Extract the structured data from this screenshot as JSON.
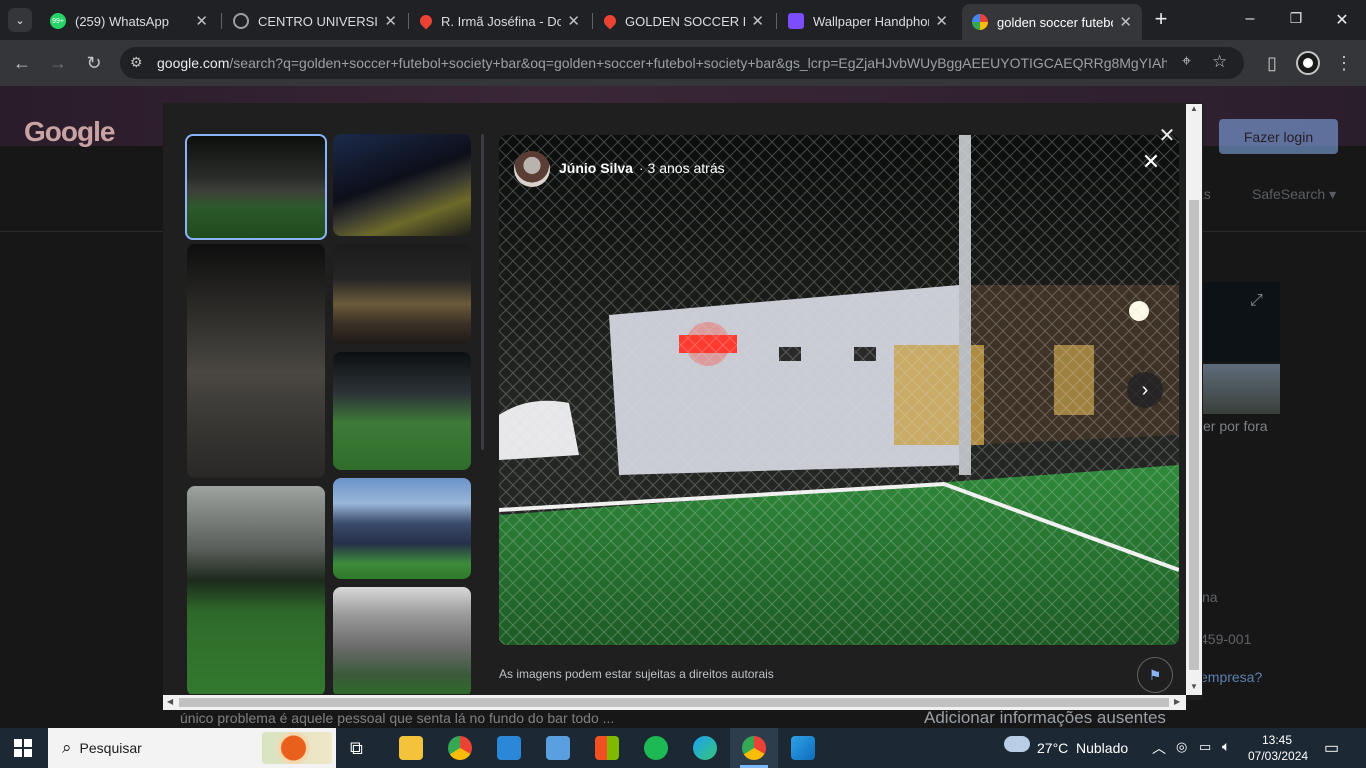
{
  "tabs": [
    {
      "title": "(259) WhatsApp",
      "icon": "whatsapp-icon",
      "color": "#25d366"
    },
    {
      "title": "CENTRO UNIVERSITÁRIO",
      "icon": "globe-icon",
      "color": "#9aa0a6"
    },
    {
      "title": "R. Irmã Joséfina - Dom",
      "icon": "maps-pin-icon",
      "color": "#ea4335"
    },
    {
      "title": "GOLDEN SOCCER Fut",
      "icon": "maps-pin-icon",
      "color": "#ea4335"
    },
    {
      "title": "Wallpaper Handphone",
      "icon": "video-icon",
      "color": "#7b4dff"
    },
    {
      "title": "golden soccer futebo",
      "icon": "google-icon",
      "color": "#4285f4"
    }
  ],
  "whatsapp_badge": "99+",
  "new_tab_label": "+",
  "toolbar": {
    "url_host": "google.com",
    "url_path": "/search?q=golden+soccer+futebol+society+bar&oq=golden+soccer+futebol+society+bar&gs_lcrp=EgZjaHJvbWUyBggAEEUYOTIGCAEQRRg8MgYIAh..."
  },
  "page": {
    "logo": "Google",
    "login_label": "Fazer login",
    "safesearch_label": "SafeSearch",
    "bg_as": "as",
    "bg_ver_por_fora": "ver por fora",
    "bg_na": "na",
    "bg_cep": "459-001",
    "bg_empresa": "empresa?",
    "bg_snippet": "único problema é aquele pessoal que senta lá no fundo do bar todo ...",
    "bg_add_info": "Adicionar informações ausentes"
  },
  "viewer": {
    "author": "Júnio Silva",
    "time": "· 3 anos atrás",
    "copyright": "As imagens podem estar sujeitas a direitos autorais"
  },
  "taskbar": {
    "search_placeholder": "Pesquisar",
    "weather_temp": "27°C",
    "weather_desc": "Nublado",
    "time": "13:45",
    "date": "07/03/2024"
  }
}
